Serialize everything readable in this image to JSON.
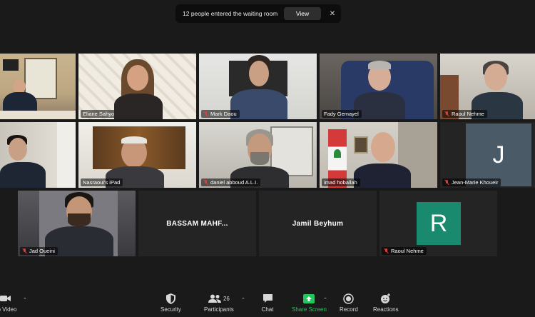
{
  "notification": {
    "message": "12 people entered the waiting room",
    "view_label": "View",
    "close_glyph": "✕"
  },
  "tiles": [
    {
      "name": "",
      "muted": false
    },
    {
      "name": "Eliane Sahyoun",
      "muted": false
    },
    {
      "name": "Mark Daou",
      "muted": true
    },
    {
      "name": "Fady Gemayel",
      "muted": false
    },
    {
      "name": "Raoul Nehme",
      "muted": true
    },
    {
      "name": "",
      "muted": false
    },
    {
      "name": "Nasraoui's iPad",
      "muted": false
    },
    {
      "name": "daniel abboud A.L.I.",
      "muted": true
    },
    {
      "name": "imad hoballah",
      "muted": false
    },
    {
      "name": "Jean-Marie Khoueir",
      "muted": true
    },
    {
      "name": "Jad Oueini",
      "muted": true
    },
    {
      "name": "BASSAM  MAHF...",
      "muted": false
    },
    {
      "name": "Jamil Beyhum",
      "muted": false
    },
    {
      "name": "Raoul Nehme",
      "muted": true
    }
  ],
  "avatars": {
    "jean_marie": {
      "letter": "J",
      "color": "#4a5a66"
    },
    "raoul": {
      "letter": "R",
      "color": "#1a8a6e"
    }
  },
  "toolbar": {
    "video_label": "op Video",
    "security_label": "Security",
    "participants_label": "Participants",
    "participants_count": "26",
    "chat_label": "Chat",
    "share_label": "Share Screen",
    "record_label": "Record",
    "reactions_label": "Reactions"
  },
  "colors": {
    "share_green": "#23c55e",
    "active_speaker": "#c6d84a",
    "muted_red": "#e03b3b"
  }
}
